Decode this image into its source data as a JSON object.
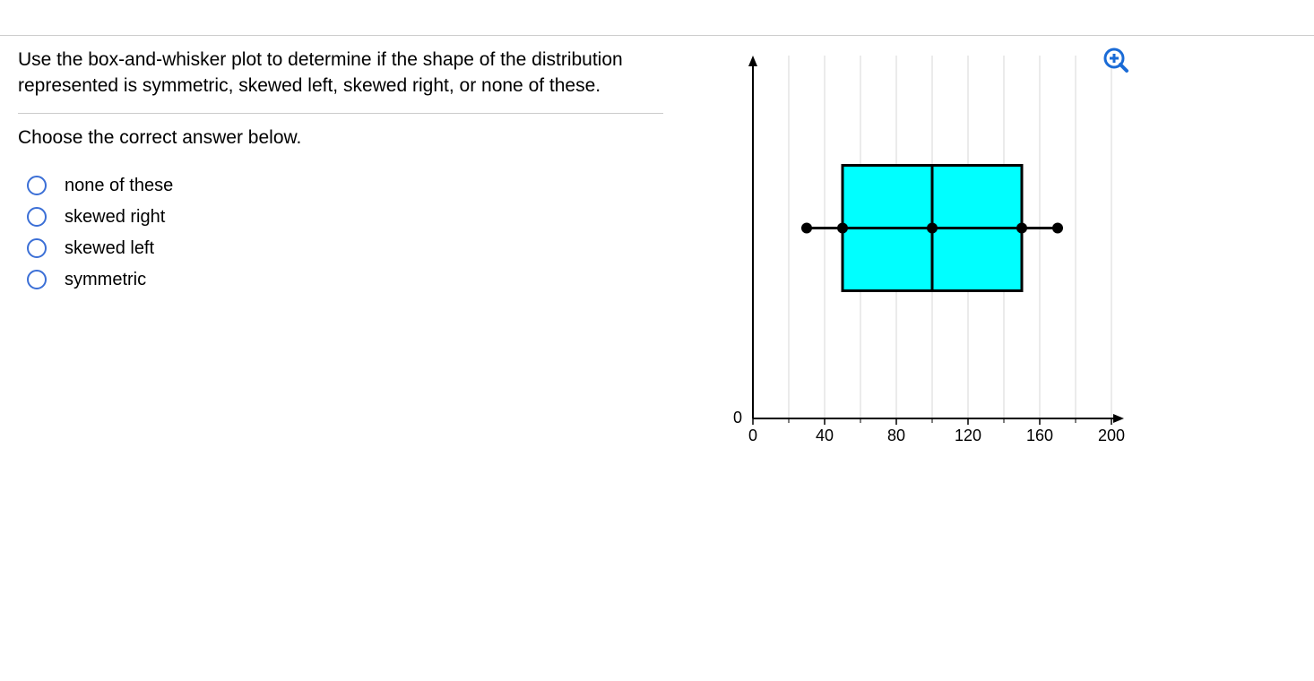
{
  "question": "Use the box-and-whisker plot to determine if the shape of the distribution represented is symmetric, skewed left, skewed right, or none of these.",
  "instruction": "Choose the correct answer below.",
  "options": [
    {
      "label": "none of these"
    },
    {
      "label": "skewed right"
    },
    {
      "label": "skewed left"
    },
    {
      "label": "symmetric"
    }
  ],
  "chart_data": {
    "type": "boxplot",
    "min": 30,
    "q1": 50,
    "median": 100,
    "q3": 150,
    "max": 170,
    "xaxis": {
      "min": 0,
      "max": 200,
      "ticks": [
        0,
        40,
        80,
        120,
        160,
        200
      ],
      "minor_step": 20
    },
    "ylabel_zero": "0",
    "box_fill": "#00ffff",
    "box_stroke": "#000000"
  },
  "icons": {
    "zoom": "zoom-in-icon"
  }
}
